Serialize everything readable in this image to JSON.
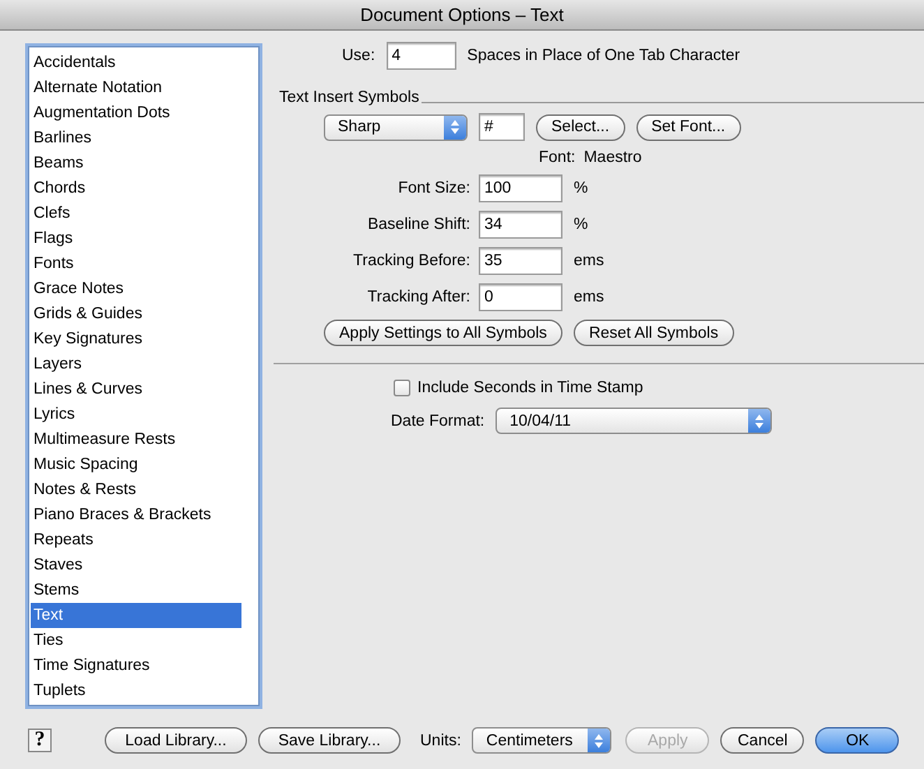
{
  "window": {
    "title": "Document Options – Text"
  },
  "sidebar": {
    "items": [
      {
        "label": "Accidentals",
        "selected": false
      },
      {
        "label": "Alternate Notation",
        "selected": false
      },
      {
        "label": "Augmentation Dots",
        "selected": false
      },
      {
        "label": "Barlines",
        "selected": false
      },
      {
        "label": "Beams",
        "selected": false
      },
      {
        "label": "Chords",
        "selected": false
      },
      {
        "label": "Clefs",
        "selected": false
      },
      {
        "label": "Flags",
        "selected": false
      },
      {
        "label": "Fonts",
        "selected": false
      },
      {
        "label": "Grace Notes",
        "selected": false
      },
      {
        "label": "Grids & Guides",
        "selected": false
      },
      {
        "label": "Key Signatures",
        "selected": false
      },
      {
        "label": "Layers",
        "selected": false
      },
      {
        "label": "Lines & Curves",
        "selected": false
      },
      {
        "label": "Lyrics",
        "selected": false
      },
      {
        "label": "Multimeasure Rests",
        "selected": false
      },
      {
        "label": "Music Spacing",
        "selected": false
      },
      {
        "label": "Notes & Rests",
        "selected": false
      },
      {
        "label": "Piano Braces & Brackets",
        "selected": false
      },
      {
        "label": "Repeats",
        "selected": false
      },
      {
        "label": "Staves",
        "selected": false
      },
      {
        "label": "Stems",
        "selected": false
      },
      {
        "label": "Text",
        "selected": true
      },
      {
        "label": "Ties",
        "selected": false
      },
      {
        "label": "Time Signatures",
        "selected": false
      },
      {
        "label": "Tuplets",
        "selected": false
      }
    ]
  },
  "tab_spaces": {
    "label": "Use:",
    "value": "4",
    "suffix": "Spaces in Place of One Tab Character"
  },
  "text_insert_symbols": {
    "heading": "Text Insert Symbols",
    "symbol_popup": "Sharp",
    "symbol_value": "#",
    "buttons": [
      "Select...",
      "Set Font..."
    ],
    "font_label": "Font:",
    "font_name": "Maestro",
    "fields": [
      {
        "label": "Font Size:",
        "value": "100",
        "unit": "%"
      },
      {
        "label": "Baseline Shift:",
        "value": "34",
        "unit": "%"
      },
      {
        "label": "Tracking Before:",
        "value": "35",
        "unit": "ems"
      },
      {
        "label": "Tracking After:",
        "value": "0",
        "unit": "ems"
      }
    ],
    "actions": [
      "Apply Settings to All Symbols",
      "Reset All Symbols"
    ]
  },
  "time_stamp": {
    "label": "Include Seconds in Time Stamp",
    "checked": false
  },
  "date_format": {
    "label": "Date Format:",
    "value": "10/04/11"
  },
  "footer": {
    "help": "?",
    "library_buttons": [
      "Load Library...",
      "Save Library..."
    ],
    "units_label": "Units:",
    "units_value": "Centimeters",
    "buttons": [
      {
        "label": "Apply",
        "disabled": true,
        "default": false
      },
      {
        "label": "Cancel",
        "disabled": false,
        "default": false
      },
      {
        "label": "OK",
        "disabled": false,
        "default": true
      }
    ]
  }
}
